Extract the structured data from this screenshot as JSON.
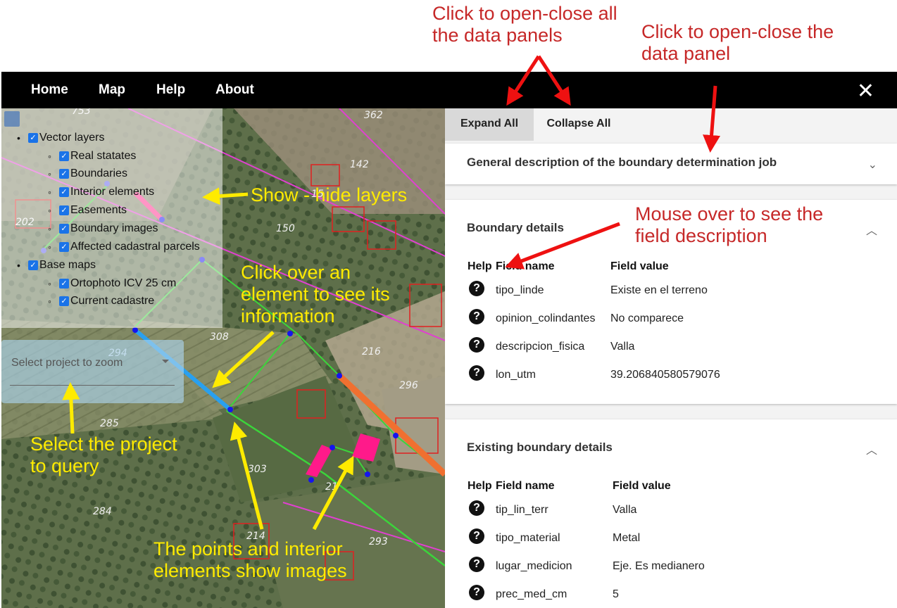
{
  "callouts": {
    "expand_collapse_all": [
      "Click to open-close all",
      "the data panels"
    ],
    "toggle_panel": [
      "Click to open-close the",
      "data panel"
    ],
    "show_hide_layers": "Show - hide layers",
    "mouse_over": [
      "Mouse over to see the",
      "field description"
    ],
    "click_element": [
      "Click over an",
      "element to see its",
      "information"
    ],
    "select_project": [
      "Select the project",
      "to query"
    ],
    "points_images": [
      "The points and interior",
      "elements show images"
    ]
  },
  "nav": {
    "home": "Home",
    "map": "Map",
    "help": "Help",
    "about": "About",
    "close_icon": "close-icon"
  },
  "layers": {
    "vector": "Vector layers",
    "real_estates": "Real statates",
    "boundaries": "Boundaries",
    "interior_elements": "Interior elements",
    "easements": "Easements",
    "boundary_images": "Boundary images",
    "affected_parcels": "Affected cadastral parcels",
    "base_maps": "Base maps",
    "ortophoto": "Ortophoto ICV 25 cm",
    "current_cadastre": "Current cadastre"
  },
  "project_select": {
    "placeholder": "Select project to zoom"
  },
  "map_labels": [
    "753",
    "362",
    "142",
    "202",
    "150",
    "308",
    "294",
    "216",
    "296",
    "285",
    "303",
    "284",
    "293",
    "214",
    "21",
    "15"
  ],
  "panel": {
    "expand_all": "Expand All",
    "collapse_all": "Collapse All",
    "general_title": "General description of the boundary determination job",
    "boundary": {
      "title": "Boundary details",
      "headers": {
        "help": "Help",
        "field": "Field name",
        "value": "Field value"
      },
      "rows": [
        {
          "name": "tipo_linde",
          "value": "Existe en el terreno"
        },
        {
          "name": "opinion_colindantes",
          "value": "No comparece"
        },
        {
          "name": "descripcion_fisica",
          "value": "Valla"
        },
        {
          "name": "lon_utm",
          "value": "39.206840580579076"
        }
      ]
    },
    "existing": {
      "title": "Existing boundary details",
      "headers": {
        "help": "Help",
        "field": "Field name",
        "value": "Field value"
      },
      "rows": [
        {
          "name": "tip_lin_terr",
          "value": "Valla"
        },
        {
          "name": "tipo_material",
          "value": "Metal"
        },
        {
          "name": "lugar_medicion",
          "value": "Eje. Es medianero"
        },
        {
          "name": "prec_med_cm",
          "value": "5"
        }
      ]
    }
  },
  "colors": {
    "red_callout": "#c62828",
    "yellow_callout": "#ffeb00",
    "navbar": "#000000",
    "checkbox": "#1a73e8"
  }
}
